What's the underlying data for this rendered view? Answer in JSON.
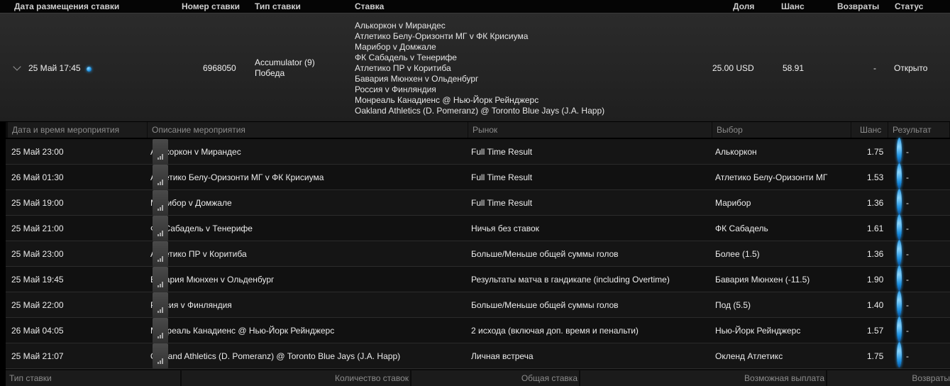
{
  "header": {
    "date": "Дата размещения ставки",
    "number": "Номер ставки",
    "type": "Тип ставки",
    "bet": "Ставка",
    "stake": "Доля",
    "odds": "Шанс",
    "returns": "Возвраты",
    "status": "Статус"
  },
  "bet": {
    "date": "25 Май 17:45",
    "number": "6968050",
    "type_line1": "Accumulator (9)",
    "type_line2": "Победа",
    "selections": [
      "Алькоркон v Мирандес",
      "Атлетико Белу-Оризонти МГ v ФК Крисиума",
      "Марибор v Домжале",
      "ФК Сабадель v Тенерифе",
      "Атлетико ПР v Коритиба",
      "Бавария Мюнхен v Ольденбург",
      "Россия v Финляндия",
      "Монреаль Канадиенс @ Нью-Йорк Рейнджерс",
      "Oakland Athletics (D. Pomeranz) @ Toronto Blue Jays (J.A. Happ)"
    ],
    "stake": "25.00 USD",
    "odds": "58.91",
    "returns": "-",
    "status": "Открыто"
  },
  "legs_header": {
    "datetime": "Дата и время мероприятия",
    "description": "Описание мероприятия",
    "market": "Рынок",
    "selection": "Выбор",
    "odds": "Шанс",
    "result": "Результат"
  },
  "legs": [
    {
      "datetime": "25 Май 23:00",
      "event": "Алькоркон v Мирандес",
      "market": "Full Time Result",
      "selection": "Алькоркон",
      "odds": "1.75",
      "result": "-"
    },
    {
      "datetime": "26 Май 01:30",
      "event": "Атлетико Белу-Оризонти МГ v ФК Крисиума",
      "market": "Full Time Result",
      "selection": "Атлетико Белу-Оризонти МГ",
      "odds": "1.53",
      "result": "-"
    },
    {
      "datetime": "25 Май 19:00",
      "event": "Марибор v Домжале",
      "market": "Full Time Result",
      "selection": "Марибор",
      "odds": "1.36",
      "result": "-"
    },
    {
      "datetime": "25 Май 21:00",
      "event": "ФК Сабадель v Тенерифе",
      "market": "Ничья без ставок",
      "selection": "ФК Сабадель",
      "odds": "1.61",
      "result": "-"
    },
    {
      "datetime": "25 Май 23:00",
      "event": "Атлетико ПР v Коритиба",
      "market": "Больше/Меньше общей суммы голов",
      "selection": "Более (1.5)",
      "odds": "1.36",
      "result": "-"
    },
    {
      "datetime": "25 Май 19:45",
      "event": "Бавария Мюнхен v Ольденбург",
      "market": "Результаты матча в гандикапе (including Overtime)",
      "selection": "Бавария Мюнхен (-11.5)",
      "odds": "1.90",
      "result": "-"
    },
    {
      "datetime": "25 Май 22:00",
      "event": "Россия v Финляндия",
      "market": "Больше/Меньше общей суммы голов",
      "selection": "Под (5.5)",
      "odds": "1.40",
      "result": "-"
    },
    {
      "datetime": "26 Май 04:05",
      "event": "Монреаль Канадиенс @ Нью-Йорк Рейнджерс",
      "market": "2 исхода (включая доп. время и пенальти)",
      "selection": "Нью-Йорк Рейнджерс",
      "odds": "1.57",
      "result": "-"
    },
    {
      "datetime": "25 Май 21:07",
      "event": "Oakland Athletics (D. Pomeranz) @ Toronto Blue Jays (J.A. Happ)",
      "market": "Личная встреча",
      "selection": "Окленд Атлетикс",
      "odds": "1.75",
      "result": "-"
    }
  ],
  "footer": {
    "type": "Тип ставки",
    "count": "Количество ставок",
    "total": "Общая ставка",
    "payout": "Возможная выплата",
    "returns": "Возвраты"
  },
  "colors": {
    "status_dot": "#1a8fe0",
    "background": "#000000",
    "row": "#151515"
  },
  "icons": [
    "chevron-down-icon",
    "status-dot-icon",
    "stats-icon"
  ]
}
